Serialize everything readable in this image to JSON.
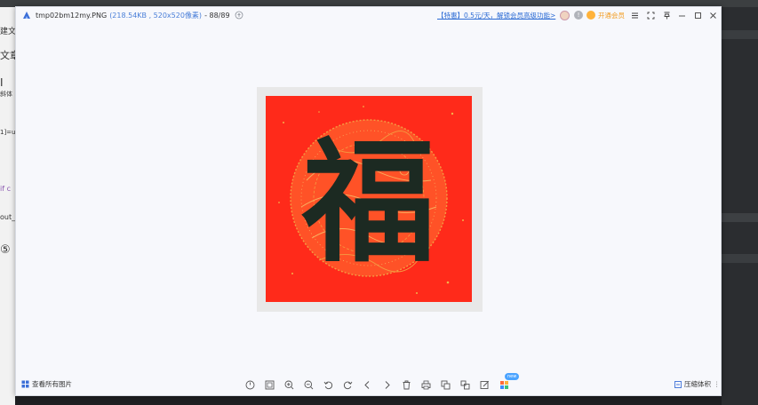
{
  "window": {
    "file_name": "tmp02bm12my.PNG",
    "file_info": "(218.54KB , 520x520像素)",
    "counter": "- 88/89",
    "promo_text": "【特惠】0.5元/天，解锁会员高级功能>",
    "vip_label": "开通会员"
  },
  "bottom_toolbar": {
    "all_photos_label": "查看所有图片",
    "compress_label": "压缩体积",
    "new_badge": "new",
    "tools": [
      "rotate-view-icon",
      "fit-icon",
      "zoom-in-icon",
      "zoom-out-icon",
      "rotate-left-icon",
      "rotate-right-icon",
      "previous-icon",
      "next-icon",
      "delete-icon",
      "print-icon",
      "copy-icon",
      "crop-icon",
      "edit-icon",
      "apps-icon"
    ]
  },
  "image": {
    "character": "福",
    "colors": {
      "paper": "#ff2a1a",
      "ink": "#1c2a22",
      "gold": "#f2b24a"
    }
  },
  "background_fragments": [
    "建文",
    "文章",
    "I",
    "斜体",
    "1]=u",
    "if c",
    "out_",
    "⑤"
  ],
  "colors": {
    "accent": "#2a6ad4",
    "vip": "#f29a1b"
  }
}
